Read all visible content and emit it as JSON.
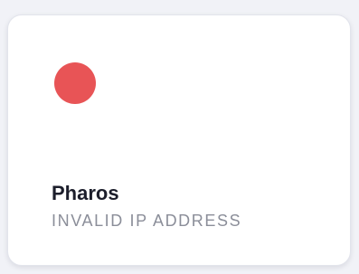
{
  "card": {
    "name": "Pharos",
    "status": "INVALID IP ADDRESS",
    "status_indicator_color": "#e85456"
  }
}
